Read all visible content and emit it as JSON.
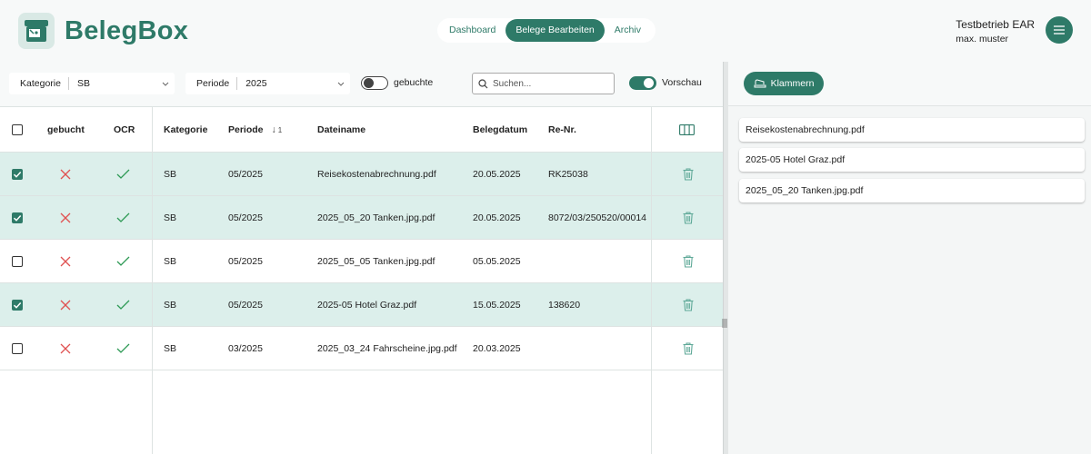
{
  "app": {
    "name": "BelegBox",
    "brand_color": "#2e7a68",
    "icon": "archive-box-icon"
  },
  "nav": {
    "items": [
      {
        "label": "Dashboard",
        "active": false
      },
      {
        "label": "Belege Bearbeiten",
        "active": true
      },
      {
        "label": "Archiv",
        "active": false
      }
    ]
  },
  "user": {
    "company": "Testbetrieb EAR",
    "name": "max. muster",
    "menu_icon": "hamburger-menu-icon"
  },
  "filters": {
    "kategorie": {
      "label": "Kategorie",
      "value": "SB"
    },
    "periode": {
      "label": "Periode",
      "value": "2025"
    },
    "gebuchte": {
      "label": "gebuchte",
      "on": false
    },
    "search": {
      "placeholder": "Suchen...",
      "value": ""
    },
    "vorschau": {
      "label": "Vorschau",
      "on": true
    }
  },
  "table": {
    "headers": {
      "gebucht": "gebucht",
      "ocr": "OCR",
      "kategorie": "Kategorie",
      "periode": "Periode",
      "sort_index": "1",
      "dateiname": "Dateiname",
      "belegdatum": "Belegdatum",
      "renr": "Re-Nr."
    },
    "rows": [
      {
        "selected": true,
        "gebucht": false,
        "ocr": true,
        "kategorie": "SB",
        "periode": "05/2025",
        "dateiname": "Reisekostenabrechnung.pdf",
        "belegdatum": "20.05.2025",
        "renr": "RK25038"
      },
      {
        "selected": true,
        "gebucht": false,
        "ocr": true,
        "kategorie": "SB",
        "periode": "05/2025",
        "dateiname": "2025_05_20 Tanken.jpg.pdf",
        "belegdatum": "20.05.2025",
        "renr": "8072/03/250520/00014"
      },
      {
        "selected": false,
        "gebucht": false,
        "ocr": true,
        "kategorie": "SB",
        "periode": "05/2025",
        "dateiname": "2025_05_05 Tanken.jpg.pdf",
        "belegdatum": "05.05.2025",
        "renr": ""
      },
      {
        "selected": true,
        "gebucht": false,
        "ocr": true,
        "kategorie": "SB",
        "periode": "05/2025",
        "dateiname": "2025-05 Hotel Graz.pdf",
        "belegdatum": "15.05.2025",
        "renr": "138620"
      },
      {
        "selected": false,
        "gebucht": false,
        "ocr": true,
        "kategorie": "SB",
        "periode": "03/2025",
        "dateiname": "2025_03_24 Fahrscheine.jpg.pdf",
        "belegdatum": "20.03.2025",
        "renr": ""
      }
    ]
  },
  "preview": {
    "button_label": "Klammern",
    "button_icon": "stapler-icon",
    "files": [
      "Reisekostenabrechnung.pdf",
      "2025-05 Hotel Graz.pdf",
      "2025_05_20 Tanken.jpg.pdf"
    ]
  },
  "colors": {
    "selected_row": "#dcefeb",
    "cross": "#e05252",
    "check": "#2e9a55"
  }
}
